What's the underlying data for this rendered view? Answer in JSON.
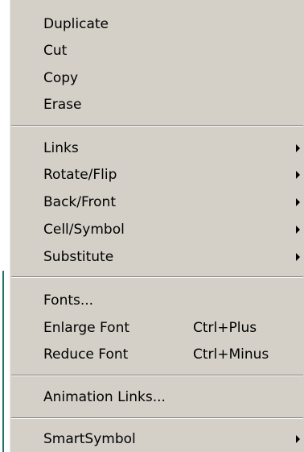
{
  "menu": {
    "items": [
      {
        "label": "Duplicate"
      },
      {
        "label": "Cut"
      },
      {
        "label": "Copy"
      },
      {
        "label": "Erase"
      },
      {
        "label": "Links"
      },
      {
        "label": "Rotate/Flip"
      },
      {
        "label": "Back/Front"
      },
      {
        "label": "Cell/Symbol"
      },
      {
        "label": "Substitute"
      },
      {
        "label": "Fonts..."
      },
      {
        "label": "Enlarge Font",
        "shortcut": "Ctrl+Plus"
      },
      {
        "label": "Reduce Font",
        "shortcut": "Ctrl+Minus"
      },
      {
        "label": "Animation Links..."
      },
      {
        "label": "SmartSymbol"
      }
    ]
  },
  "icons": {
    "submenu_arrow": "chevron-right-icon"
  },
  "colors": {
    "menu_background": "#d4d0c8",
    "separator_shadow": "#808080",
    "separator_highlight": "#ffffff",
    "app_edge_accent": "#0e7a6a"
  }
}
